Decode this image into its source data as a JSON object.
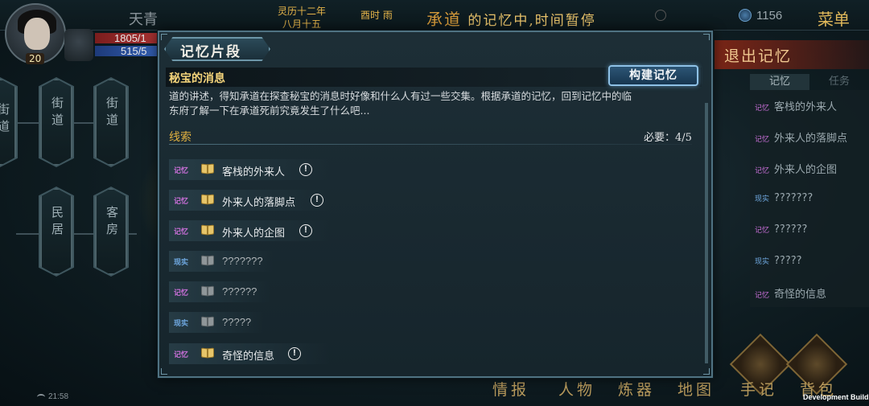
{
  "topbar": {
    "player_name": "天青",
    "level": "20",
    "hp": "1805/1",
    "mp": "515/5",
    "date_line1": "灵历十二年",
    "date_line2": "八月十五",
    "time": "酉时 雨",
    "banner_highlight": "承道",
    "banner_rest": "的记忆中,时间暂停",
    "currency": "1156",
    "menu_label": "菜单"
  },
  "map": {
    "nodes": [
      "街道",
      "街道",
      "街道",
      "民居",
      "客房"
    ]
  },
  "side_panel": {
    "exit_label": "退出记忆",
    "tabs": [
      "记忆",
      "任务"
    ],
    "items": [
      {
        "tag": "记忆",
        "kind": "mem",
        "label": "客栈的外来人"
      },
      {
        "tag": "记忆",
        "kind": "mem",
        "label": "外来人的落脚点"
      },
      {
        "tag": "记忆",
        "kind": "mem",
        "label": "外来人的企图"
      },
      {
        "tag": "现实",
        "kind": "real",
        "label": "???????"
      },
      {
        "tag": "记忆",
        "kind": "mem",
        "label": "??????"
      },
      {
        "tag": "现实",
        "kind": "real",
        "label": "?????"
      },
      {
        "tag": "记忆",
        "kind": "mem",
        "label": "奇怪的信息"
      }
    ]
  },
  "dialog": {
    "title": "记忆片段",
    "subtitle": "秘宝的消息",
    "build_button": "构建记忆",
    "description_line1": "道的讲述，得知承道在探查秘宝的消息时好像和什么人有过一些交集。根据承道的记忆，回到记忆中的临",
    "description_line2": "东府了解一下在承道死前究竟发生了什么吧...",
    "clue_header": "线索",
    "required": "必要：4/5",
    "clues": [
      {
        "tag": "记忆",
        "kind": "mem",
        "label": "客栈的外来人",
        "known": true,
        "alert": "!"
      },
      {
        "tag": "记忆",
        "kind": "mem",
        "label": "外来人的落脚点",
        "known": true,
        "alert": "!"
      },
      {
        "tag": "记忆",
        "kind": "mem",
        "label": "外来人的企图",
        "known": true,
        "alert": "!"
      },
      {
        "tag": "现实",
        "kind": "real",
        "label": "???????",
        "known": false,
        "alert": ""
      },
      {
        "tag": "记忆",
        "kind": "mem",
        "label": "??????",
        "known": false,
        "alert": ""
      },
      {
        "tag": "现实",
        "kind": "real",
        "label": "?????",
        "known": false,
        "alert": ""
      },
      {
        "tag": "记忆",
        "kind": "mem",
        "label": "奇怪的信息",
        "known": true,
        "alert": "!"
      }
    ]
  },
  "bottom_nav": [
    "情报",
    "人物",
    "炼器",
    "地图",
    "手记",
    "背包"
  ],
  "status": {
    "clock": "21:58",
    "dev_build": "Development Build"
  },
  "colors": {
    "memory_tag": "#c96fd8",
    "reality_tag": "#6fa8e0",
    "accent_gold": "#e0b040",
    "button_blue": "#8ec1e6"
  }
}
